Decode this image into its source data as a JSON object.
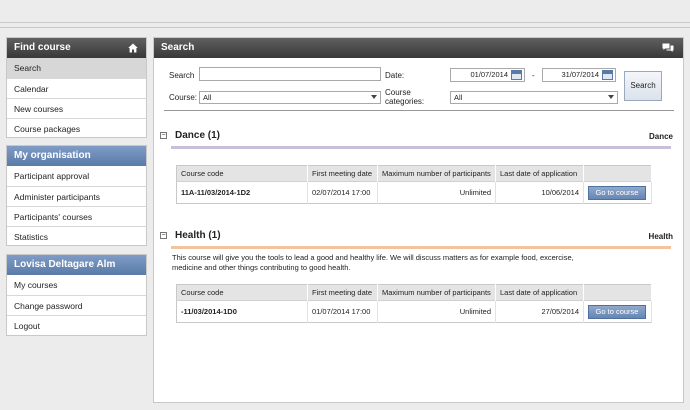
{
  "sidebar": {
    "find_course": {
      "title": "Find course",
      "items": [
        {
          "label": "Search"
        },
        {
          "label": "Calendar"
        },
        {
          "label": "New courses"
        },
        {
          "label": "Course packages"
        }
      ]
    },
    "my_organisation": {
      "title": "My organisation",
      "items": [
        {
          "label": "Participant approval"
        },
        {
          "label": "Administer participants"
        },
        {
          "label": "Participants' courses"
        },
        {
          "label": "Statistics"
        }
      ]
    },
    "user": {
      "title": "Lovisa Deltagare Alm",
      "items": [
        {
          "label": "My courses"
        },
        {
          "label": "Change password"
        },
        {
          "label": "Logout"
        }
      ]
    }
  },
  "main": {
    "title": "Search",
    "form": {
      "search_label": "Search",
      "search_value": "",
      "course_label": "Course:",
      "course_value": "All",
      "date_label": "Date:",
      "date_from": "01/07/2014",
      "date_sep": "-",
      "date_to": "31/07/2014",
      "categories_label_1": "Course",
      "categories_label_2": "categories:",
      "categories_value": "All",
      "search_button": "Search"
    },
    "columns": [
      "Course code",
      "First meeting date",
      "Maximum number of participants",
      "Last date of application"
    ],
    "sections": [
      {
        "toggle": "−",
        "title": "Dance (1)",
        "tag": "Dance",
        "description": "",
        "rows": [
          {
            "code": "11A-11/03/2014-1D2",
            "first_meeting": "02/07/2014 17:00",
            "max": "Unlimited",
            "last_date": "10/06/2014",
            "button": "Go to course"
          }
        ]
      },
      {
        "toggle": "−",
        "title": "Health (1)",
        "tag": "Health",
        "description": "This course will give you the tools to lead a good and healthy life. We will discuss matters as for example food, excercise, medicine and other things contributing to good health.",
        "rows": [
          {
            "code": "-11/03/2014-1D0",
            "first_meeting": "01/07/2014 17:00",
            "max": "Unlimited",
            "last_date": "27/05/2014",
            "button": "Go to course"
          }
        ]
      }
    ]
  },
  "colors": {
    "dance_line": "#cbbed8",
    "health_line": "#f2c49c",
    "accent_blue": "#6686b3"
  }
}
